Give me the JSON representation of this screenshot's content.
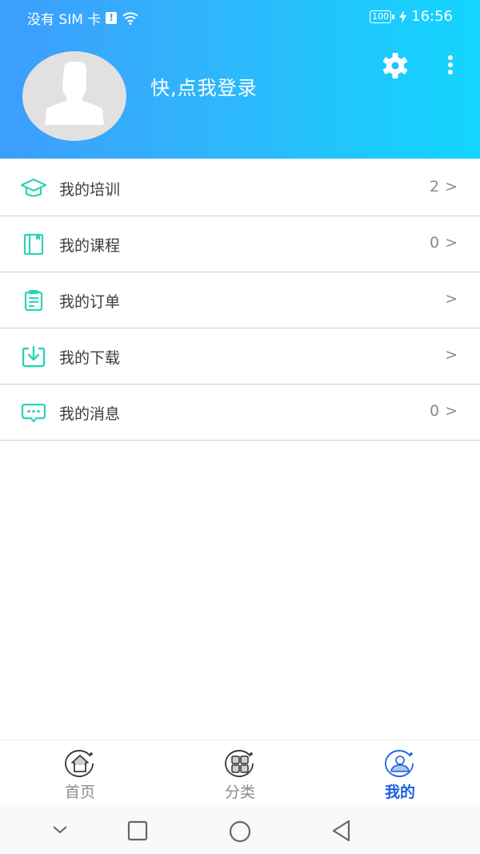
{
  "status_bar": {
    "carrier": "没有 SIM 卡",
    "sim_alert": "!",
    "battery": "100",
    "time": "16:56"
  },
  "header": {
    "login_prompt": "快,点我登录",
    "icons": [
      "user-avatar-placeholder",
      "gear-icon",
      "more-vertical-icon"
    ]
  },
  "colors": {
    "header_gradient_start": "#3d9dfd",
    "header_gradient_end": "#12d6fd",
    "icon_accent": "#2ed3b7",
    "active_tab": "#1d5fe0",
    "inactive_tab": "#8c8c8c"
  },
  "menu": {
    "items": [
      {
        "label": "我的培训",
        "count": "2",
        "arrow": ">",
        "icon": "graduation-cap-icon"
      },
      {
        "label": "我的课程",
        "count": "0",
        "arrow": ">",
        "icon": "book-icon"
      },
      {
        "label": "我的订单",
        "count": "",
        "arrow": ">",
        "icon": "clipboard-icon"
      },
      {
        "label": "我的下载",
        "count": "",
        "arrow": ">",
        "icon": "download-icon"
      },
      {
        "label": "我的消息",
        "count": "0",
        "arrow": ">",
        "icon": "message-icon"
      }
    ]
  },
  "tabbar": {
    "tabs": [
      {
        "label": "首页",
        "icon": "home-icon",
        "active": false
      },
      {
        "label": "分类",
        "icon": "category-grid-icon",
        "active": false
      },
      {
        "label": "我的",
        "icon": "profile-icon",
        "active": true
      }
    ]
  },
  "system_nav": {
    "buttons": [
      "collapse-chevron-icon",
      "recents-square-icon",
      "home-circle-icon",
      "back-triangle-icon"
    ]
  }
}
